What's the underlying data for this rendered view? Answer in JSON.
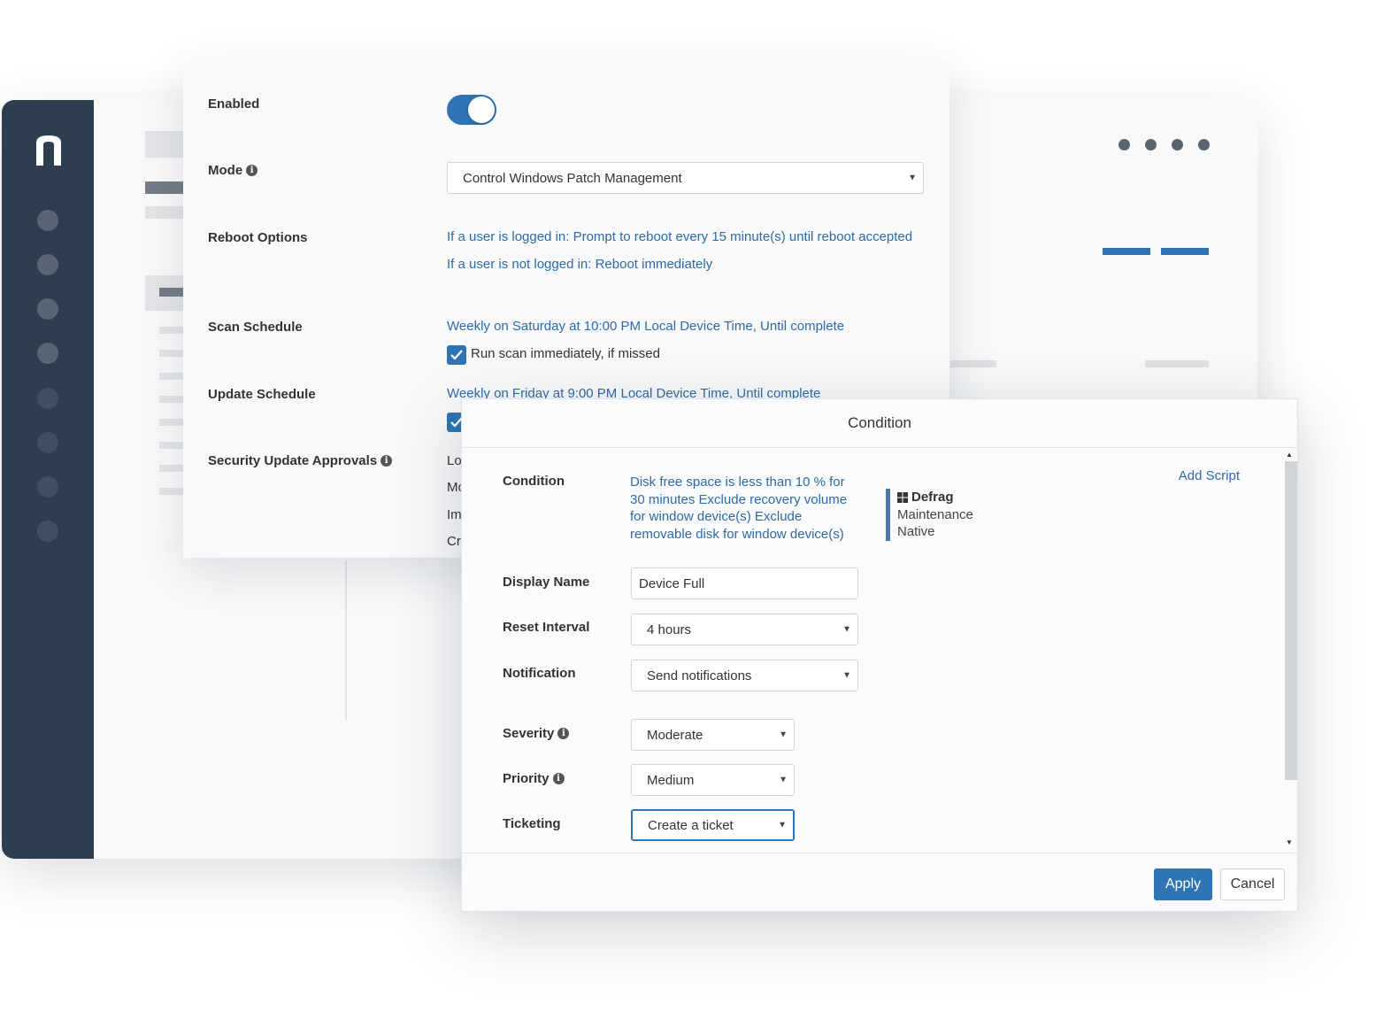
{
  "colors": {
    "accent": "#2f74b4",
    "sidebar": "#2d3e50",
    "link": "#2f6aa6"
  },
  "app": {
    "logo_icon": "n-logo-icon"
  },
  "settings": {
    "enabled_label": "Enabled",
    "enabled_state": true,
    "mode_label": "Mode",
    "mode_value": "Control Windows Patch Management",
    "reboot_label": "Reboot Options",
    "reboot_logged_in": "If a user is logged in: Prompt to reboot every 15 minute(s) until reboot accepted",
    "reboot_not_logged_in": "If a user is not logged in: Reboot immediately",
    "scan_label": "Scan Schedule",
    "scan_value": "Weekly on Saturday at 10:00 PM Local Device Time, Until complete",
    "scan_checkbox_label": "Run scan immediately, if missed",
    "scan_checkbox_checked": true,
    "update_label": "Update Schedule",
    "update_value": "Weekly on Friday at 9:00 PM Local Device Time, Until complete",
    "approvals_label": "Security Update Approvals",
    "approvals_clipped": [
      "Lo",
      "Mo",
      "Im",
      "Cr"
    ]
  },
  "dialog": {
    "title": "Condition",
    "condition_label": "Condition",
    "condition_text": "Disk free space is less than 10 % for 30 minutes Exclude recovery volume for window device(s) Exclude removable disk for window device(s)",
    "script_name": "Defrag",
    "script_category": "Maintenance",
    "script_type": "Native",
    "add_script_link": "Add Script",
    "display_name_label": "Display Name",
    "display_name_value": "Device Full",
    "reset_interval_label": "Reset Interval",
    "reset_interval_value": "4 hours",
    "notification_label": "Notification",
    "notification_value": "Send notifications",
    "severity_label": "Severity",
    "severity_value": "Moderate",
    "priority_label": "Priority",
    "priority_value": "Medium",
    "ticketing_label": "Ticketing",
    "ticketing_value": "Create a ticket",
    "apply_button": "Apply",
    "cancel_button": "Cancel"
  }
}
